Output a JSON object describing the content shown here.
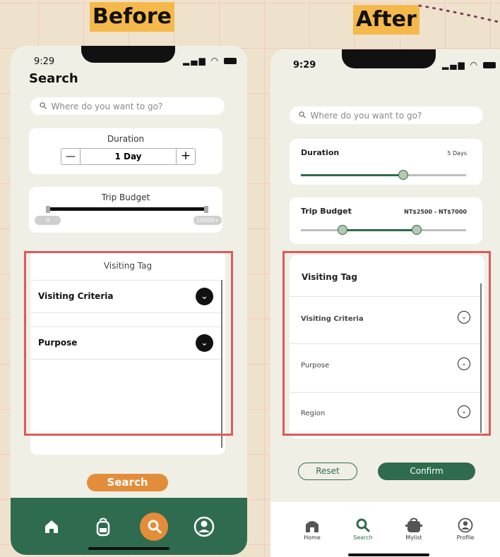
{
  "labels": {
    "before": "Before",
    "after": "After"
  },
  "colors": {
    "accent_green": "#2f6b4f",
    "search_orange": "#e38d3a",
    "highlight_red": "#dc5b5b",
    "headline_yellow": "#f5b94b"
  },
  "before": {
    "status": {
      "time": "9:29",
      "icons": "..ıl ⌔"
    },
    "title": "Search",
    "search_placeholder": "Where do you want to go?",
    "duration": {
      "label": "Duration",
      "minus": "—",
      "value": "1 Day",
      "plus": "+"
    },
    "budget": {
      "label": "Trip Budget",
      "min_label": "0",
      "max_label": "10000+"
    },
    "visiting": {
      "header": "Visiting Tag",
      "items": [
        {
          "label": "Visiting Criteria",
          "icon": "chevron-down-icon"
        },
        {
          "label": "Purpose",
          "icon": "chevron-down-icon"
        }
      ]
    },
    "search_button": "Search",
    "nav": [
      {
        "icon": "home-icon"
      },
      {
        "icon": "backpack-icon"
      },
      {
        "icon": "search-icon",
        "active": true
      },
      {
        "icon": "profile-icon"
      }
    ]
  },
  "after": {
    "status": {
      "time": "9:29",
      "icons": "..ıl ⌔"
    },
    "search_placeholder": "Where do you want to go?",
    "duration": {
      "label": "Duration",
      "value": "5 Days",
      "slider_fraction": 0.62
    },
    "budget": {
      "label": "Trip Budget",
      "value": "NT$2500 - NT$7000",
      "range_low": 2500,
      "range_high": 7000
    },
    "visiting": {
      "header": "Visiting Tag",
      "items": [
        {
          "label": "Visiting Criteria"
        },
        {
          "label": "Purpose"
        },
        {
          "label": "Region"
        }
      ]
    },
    "reset_button": "Reset",
    "confirm_button": "Confirm",
    "nav": [
      {
        "label": "Home",
        "icon": "home-icon"
      },
      {
        "label": "Search",
        "icon": "search-icon",
        "active": true
      },
      {
        "label": "Mylist",
        "icon": "backpack-icon"
      },
      {
        "label": "Profile",
        "icon": "profile-icon"
      }
    ]
  }
}
